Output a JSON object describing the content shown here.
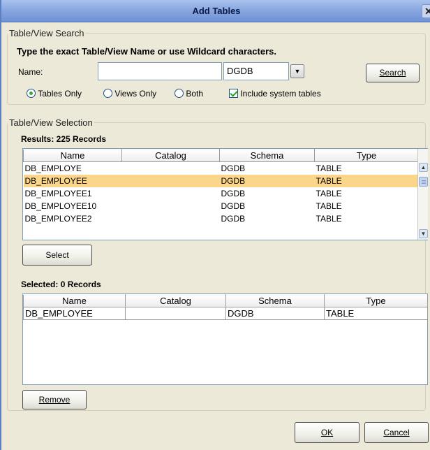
{
  "dialog": {
    "title": "Add Tables",
    "close_glyph": "✕"
  },
  "search": {
    "legend": "Table/View Search",
    "instruction": "Type the exact Table/View Name or use Wildcard characters.",
    "name_label": "Name:",
    "name_value": "",
    "schema_value": "DGDB",
    "search_button": "Search",
    "options": {
      "tables_only": "Tables Only",
      "views_only": "Views Only",
      "both": "Both",
      "include_system": "Include system tables",
      "selected": "tables_only",
      "include_system_checked": true
    }
  },
  "selection": {
    "legend": "Table/View Selection",
    "results_label": "Results: 225 Records",
    "columns": [
      "Name",
      "Catalog",
      "Schema",
      "Type"
    ],
    "rows": [
      {
        "name": "DB_EMPLOYE",
        "catalog": "",
        "schema": "DGDB",
        "type": "TABLE"
      },
      {
        "name": "DB_EMPLOYEE",
        "catalog": "",
        "schema": "DGDB",
        "type": "TABLE",
        "selected": true
      },
      {
        "name": "DB_EMPLOYEE1",
        "catalog": "",
        "schema": "DGDB",
        "type": "TABLE"
      },
      {
        "name": "DB_EMPLOYEE10",
        "catalog": "",
        "schema": "DGDB",
        "type": "TABLE"
      },
      {
        "name": "DB_EMPLOYEE2",
        "catalog": "",
        "schema": "DGDB",
        "type": "TABLE"
      }
    ],
    "select_button": "Select",
    "selected_label": "Selected: 0 Records",
    "selected_rows": [
      {
        "name": "DB_EMPLOYEE",
        "catalog": "",
        "schema": "DGDB",
        "type": "TABLE"
      }
    ],
    "remove_button": "Remove"
  },
  "footer": {
    "ok_button": "OK",
    "cancel_button": "Cancel"
  },
  "icons": {
    "dropdown": "chevron-down-icon",
    "scroll_up": "arrow-up-icon",
    "scroll_down": "arrow-down-icon",
    "close": "close-icon"
  }
}
